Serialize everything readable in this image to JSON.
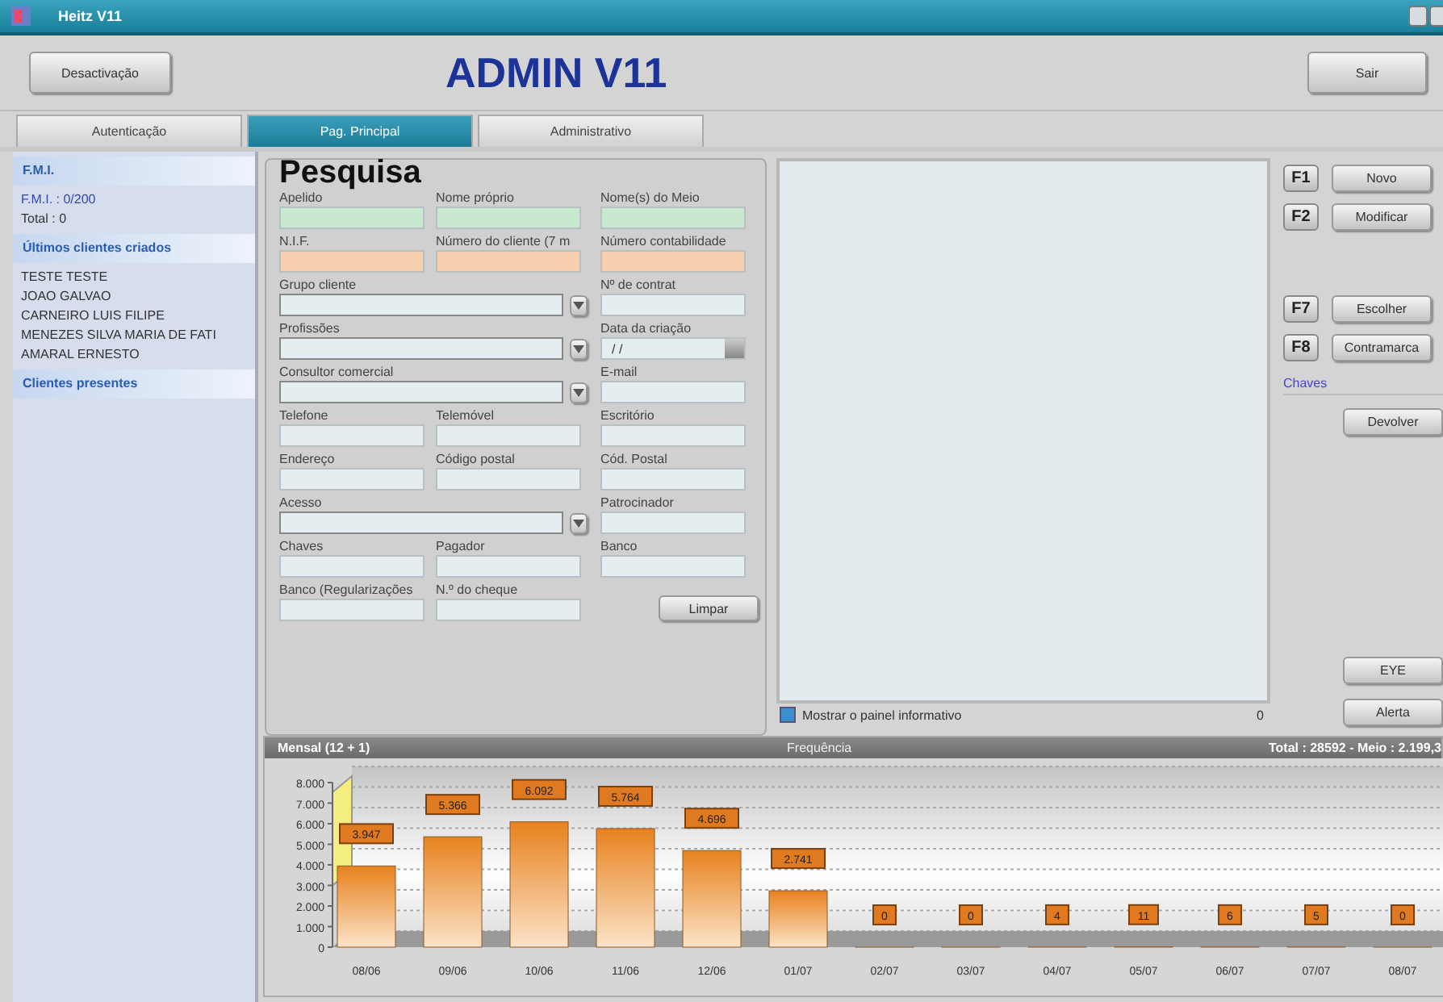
{
  "window": {
    "title": "Heitz V11"
  },
  "header": {
    "left_button": "Desactivação",
    "title": "ADMIN V11",
    "right_button": "Sair"
  },
  "tabs": [
    {
      "label": "Autenticação",
      "selected": false
    },
    {
      "label": "Pag. Principal",
      "selected": true
    },
    {
      "label": "Administrativo",
      "selected": false
    }
  ],
  "sidebar": {
    "sections": [
      {
        "title": "F.M.I.",
        "lines": [
          {
            "text": "F.M.I. : 0/200",
            "kind": "link"
          },
          {
            "text": "Total : 0",
            "kind": "plain"
          }
        ]
      },
      {
        "title": "Últimos clientes criados",
        "lines": [
          {
            "text": "TESTE TESTE",
            "kind": "plain"
          },
          {
            "text": "JOAO GALVAO",
            "kind": "plain"
          },
          {
            "text": "CARNEIRO LUIS FILIPE",
            "kind": "plain"
          },
          {
            "text": "MENEZES SILVA MARIA DE FATI",
            "kind": "plain"
          },
          {
            "text": "AMARAL ERNESTO",
            "kind": "plain"
          }
        ]
      },
      {
        "title": "Clientes presentes"
      }
    ]
  },
  "search": {
    "title": "Pesquisa",
    "clear_button": "Limpar",
    "rows": [
      [
        {
          "label": "Apelido",
          "kind": "text",
          "color": "#c8e8d0"
        },
        {
          "label": "Nome próprio",
          "kind": "text",
          "color": "#c8e8d0"
        },
        {
          "label": "Nome(s) do Meio",
          "kind": "text",
          "color": "#c8e8d0"
        }
      ],
      [
        {
          "label": "N.I.F.",
          "kind": "text",
          "color": "#f8d0b0"
        },
        {
          "label": "Número do cliente (7 m",
          "kind": "text",
          "color": "#f8d0b0"
        },
        {
          "label": "Número contabilidade",
          "kind": "text",
          "color": "#f8d0b0"
        }
      ],
      [
        {
          "label": "Grupo cliente",
          "kind": "combo"
        },
        {
          "label": "Nº de contrat",
          "kind": "text"
        }
      ],
      [
        {
          "label": "Profissões",
          "kind": "combo"
        },
        {
          "label": "Data da criação",
          "kind": "date",
          "value": " / /"
        }
      ],
      [
        {
          "label": "Consultor comercial",
          "kind": "combo"
        },
        {
          "label": "E-mail",
          "kind": "text"
        }
      ],
      [
        {
          "label": "Telefone",
          "kind": "text"
        },
        {
          "label": "Telemóvel",
          "kind": "text"
        },
        {
          "label": "Escritório",
          "kind": "text"
        }
      ],
      [
        {
          "label": "Endereço",
          "kind": "text"
        },
        {
          "label": "Código postal",
          "kind": "text"
        },
        {
          "label": "Cód. Postal",
          "kind": "text"
        }
      ],
      [
        {
          "label": "Acesso",
          "kind": "combo"
        },
        {
          "label": "Patrocinador",
          "kind": "text"
        }
      ],
      [
        {
          "label": "Chaves",
          "kind": "text"
        },
        {
          "label": "Pagador",
          "kind": "text"
        },
        {
          "label": "Banco",
          "kind": "text"
        }
      ],
      [
        {
          "label": "Banco (Regularizações",
          "kind": "text"
        },
        {
          "label": "N.º do cheque",
          "kind": "text"
        },
        {
          "kind": "clear"
        }
      ]
    ]
  },
  "info_panel": {
    "checkbox": {
      "label": "Mostrar o painel informativo",
      "checked": true
    },
    "count": "0"
  },
  "actions": {
    "top": [
      {
        "key": "F1",
        "label": "Novo"
      },
      {
        "key": "F2",
        "label": "Modificar"
      }
    ],
    "middle": [
      {
        "key": "F7",
        "label": "Escolher"
      },
      {
        "key": "F8",
        "label": "Contramarca"
      }
    ],
    "keys_caption": "Chaves",
    "keys_buttons": [
      "Devolver"
    ],
    "bottom": [
      "EYE",
      "Alerta"
    ]
  },
  "chart": {
    "period": "Mensal (12 + 1)",
    "summary": "Total : 28592 - Meio : 2.199,3",
    "chart_data": {
      "type": "bar",
      "title": "Frequência",
      "categories": [
        "08/06",
        "09/06",
        "10/06",
        "11/06",
        "12/06",
        "01/07",
        "02/07",
        "03/07",
        "04/07",
        "05/07",
        "06/07",
        "07/07",
        "08/07"
      ],
      "values": [
        3947,
        5366,
        6092,
        5764,
        4696,
        2741,
        0,
        0,
        4,
        11,
        6,
        5,
        0
      ],
      "value_labels": [
        "3.947",
        "5.366",
        "6.092",
        "5.764",
        "4.696",
        "2.741",
        "0",
        "0",
        "4",
        "11",
        "6",
        "5",
        "0"
      ],
      "ylim": [
        0,
        8000
      ],
      "yticks": [
        {
          "value": 0,
          "label": "0"
        },
        {
          "value": 1000,
          "label": "1.000"
        },
        {
          "value": 2000,
          "label": "2.000"
        },
        {
          "value": 3000,
          "label": "3.000"
        },
        {
          "value": 4000,
          "label": "4.000"
        },
        {
          "value": 5000,
          "label": "5.000"
        },
        {
          "value": 6000,
          "label": "6.000"
        },
        {
          "value": 7000,
          "label": "7.000"
        },
        {
          "value": 8000,
          "label": "8.000"
        }
      ]
    }
  }
}
